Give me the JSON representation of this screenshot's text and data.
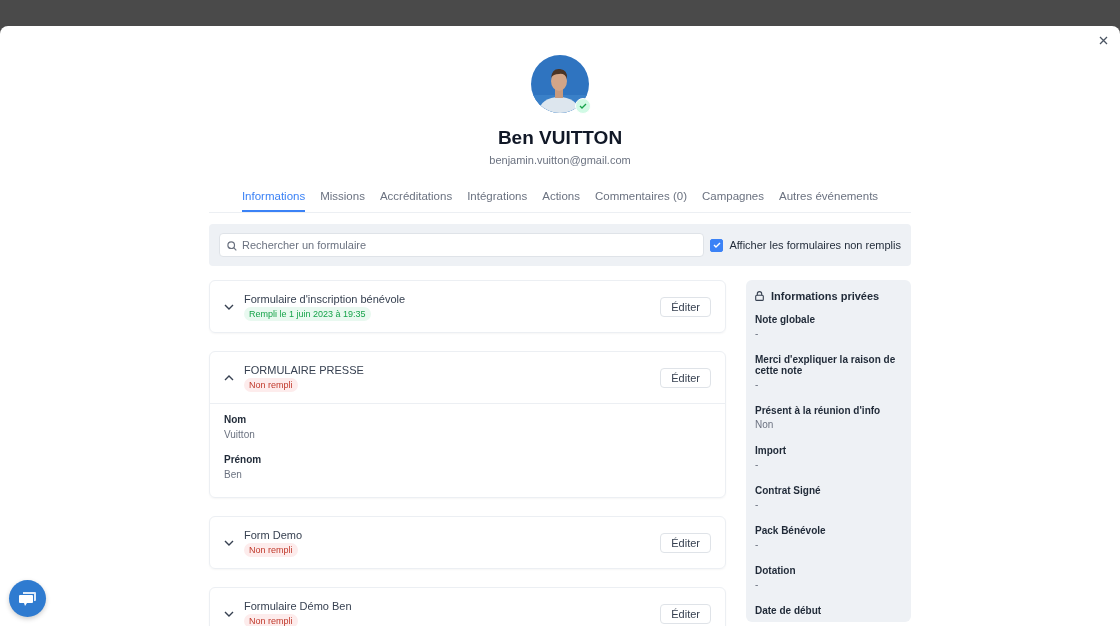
{
  "profile": {
    "name": "Ben VUITTON",
    "email": "benjamin.vuitton@gmail.com",
    "verified": true
  },
  "tabs": [
    {
      "label": "Informations",
      "selected": true
    },
    {
      "label": "Missions",
      "selected": false
    },
    {
      "label": "Accréditations",
      "selected": false
    },
    {
      "label": "Intégrations",
      "selected": false
    },
    {
      "label": "Actions",
      "selected": false
    },
    {
      "label": "Commentaires (0)",
      "selected": false
    },
    {
      "label": "Campagnes",
      "selected": false
    },
    {
      "label": "Autres événements",
      "selected": false
    }
  ],
  "search": {
    "placeholder": "Rechercher un formulaire"
  },
  "show_unfilled": {
    "label": "Afficher les formulaires non remplis",
    "checked": true
  },
  "forms": [
    {
      "title": "Formulaire d'inscription bénévole",
      "status": "Rempli le 1 juin 2023 à 19:35",
      "kind": "filled",
      "expanded": false,
      "button": "Éditer"
    },
    {
      "title": "FORMULAIRE PRESSE",
      "status": "Non rempli",
      "kind": "unfilled",
      "expanded": true,
      "button": "Éditer",
      "fields": [
        {
          "label": "Nom",
          "value": "Vuitton"
        },
        {
          "label": "Prénom",
          "value": "Ben"
        }
      ]
    },
    {
      "title": "Form Demo",
      "status": "Non rempli",
      "kind": "unfilled",
      "expanded": false,
      "button": "Éditer"
    },
    {
      "title": "Formulaire Démo Ben",
      "status": "Non rempli",
      "kind": "unfilled",
      "expanded": false,
      "button": "Éditer"
    }
  ],
  "private_info": {
    "title": "Informations privées",
    "fields": [
      {
        "label": "Note globale",
        "value": "-"
      },
      {
        "label": "Merci d'expliquer la raison de cette note",
        "value": "-"
      },
      {
        "label": "Présent à la réunion d'info",
        "value": "Non"
      },
      {
        "label": "Import",
        "value": "-"
      },
      {
        "label": "Contrat Signé",
        "value": "-"
      },
      {
        "label": "Pack Bénévole",
        "value": "-"
      },
      {
        "label": "Dotation",
        "value": "-"
      },
      {
        "label": "Date de début"
      }
    ]
  }
}
